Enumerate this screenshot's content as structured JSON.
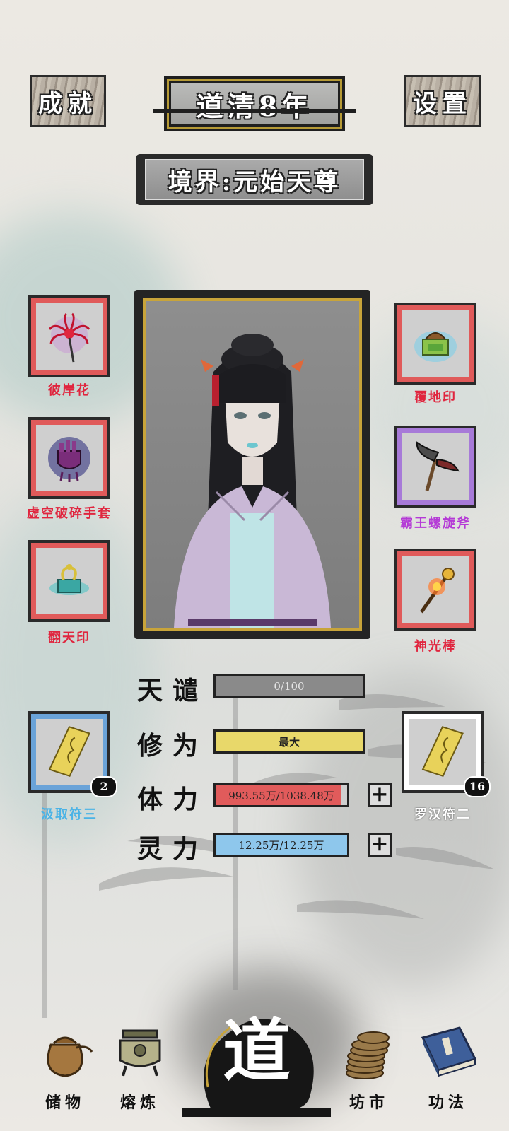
{
  "header": {
    "achievements_label": "成就",
    "settings_label": "设置",
    "era_title": "道清8年",
    "realm_text": "境界:元始天尊"
  },
  "equipment_left": [
    {
      "name": "彼岸花",
      "color": "#e0253e"
    },
    {
      "name": "虚空破碎手套",
      "color": "#e0253e"
    },
    {
      "name": "翻天印",
      "color": "#e0253e"
    }
  ],
  "equipment_right": [
    {
      "name": "覆地印",
      "color": "#e0253e"
    },
    {
      "name": "霸王螺旋斧",
      "color": "#b43ad6"
    },
    {
      "name": "神光棒",
      "color": "#e0253e"
    }
  ],
  "talismans": {
    "left": {
      "name": "汲取符三",
      "count": "2",
      "color": "#4ab3e6"
    },
    "right": {
      "name": "罗汉符二",
      "count": "16",
      "color": "#ffffff"
    }
  },
  "stats": {
    "tribulation": {
      "label": "天谴",
      "value": "0/100",
      "fill": 0.0
    },
    "cultivation": {
      "label": "修为",
      "value": "最大",
      "fill": 1.0
    },
    "stamina": {
      "label": "体力",
      "value": "993.55万/1038.48万",
      "fill": 0.957
    },
    "spirit": {
      "label": "灵力",
      "value": "12.25万/12.25万",
      "fill": 1.0
    },
    "plus_symbol": "+"
  },
  "bottom_nav": {
    "storage": "储物",
    "smelting": "熔炼",
    "dao": "道",
    "market": "坊市",
    "skills": "功法"
  },
  "colors": {
    "slot_red": "#e05a5a",
    "slot_purple": "#a77ad8",
    "slot_blue": "#6aa3d8",
    "slot_white": "#ffffff",
    "stamina_bar": "#e15b5b",
    "cultivation_bar": "#e8d86a",
    "spirit_bar": "#8ec7ec",
    "tribulation_bar": "#8a8a8a",
    "gold": "#c8a43a"
  }
}
